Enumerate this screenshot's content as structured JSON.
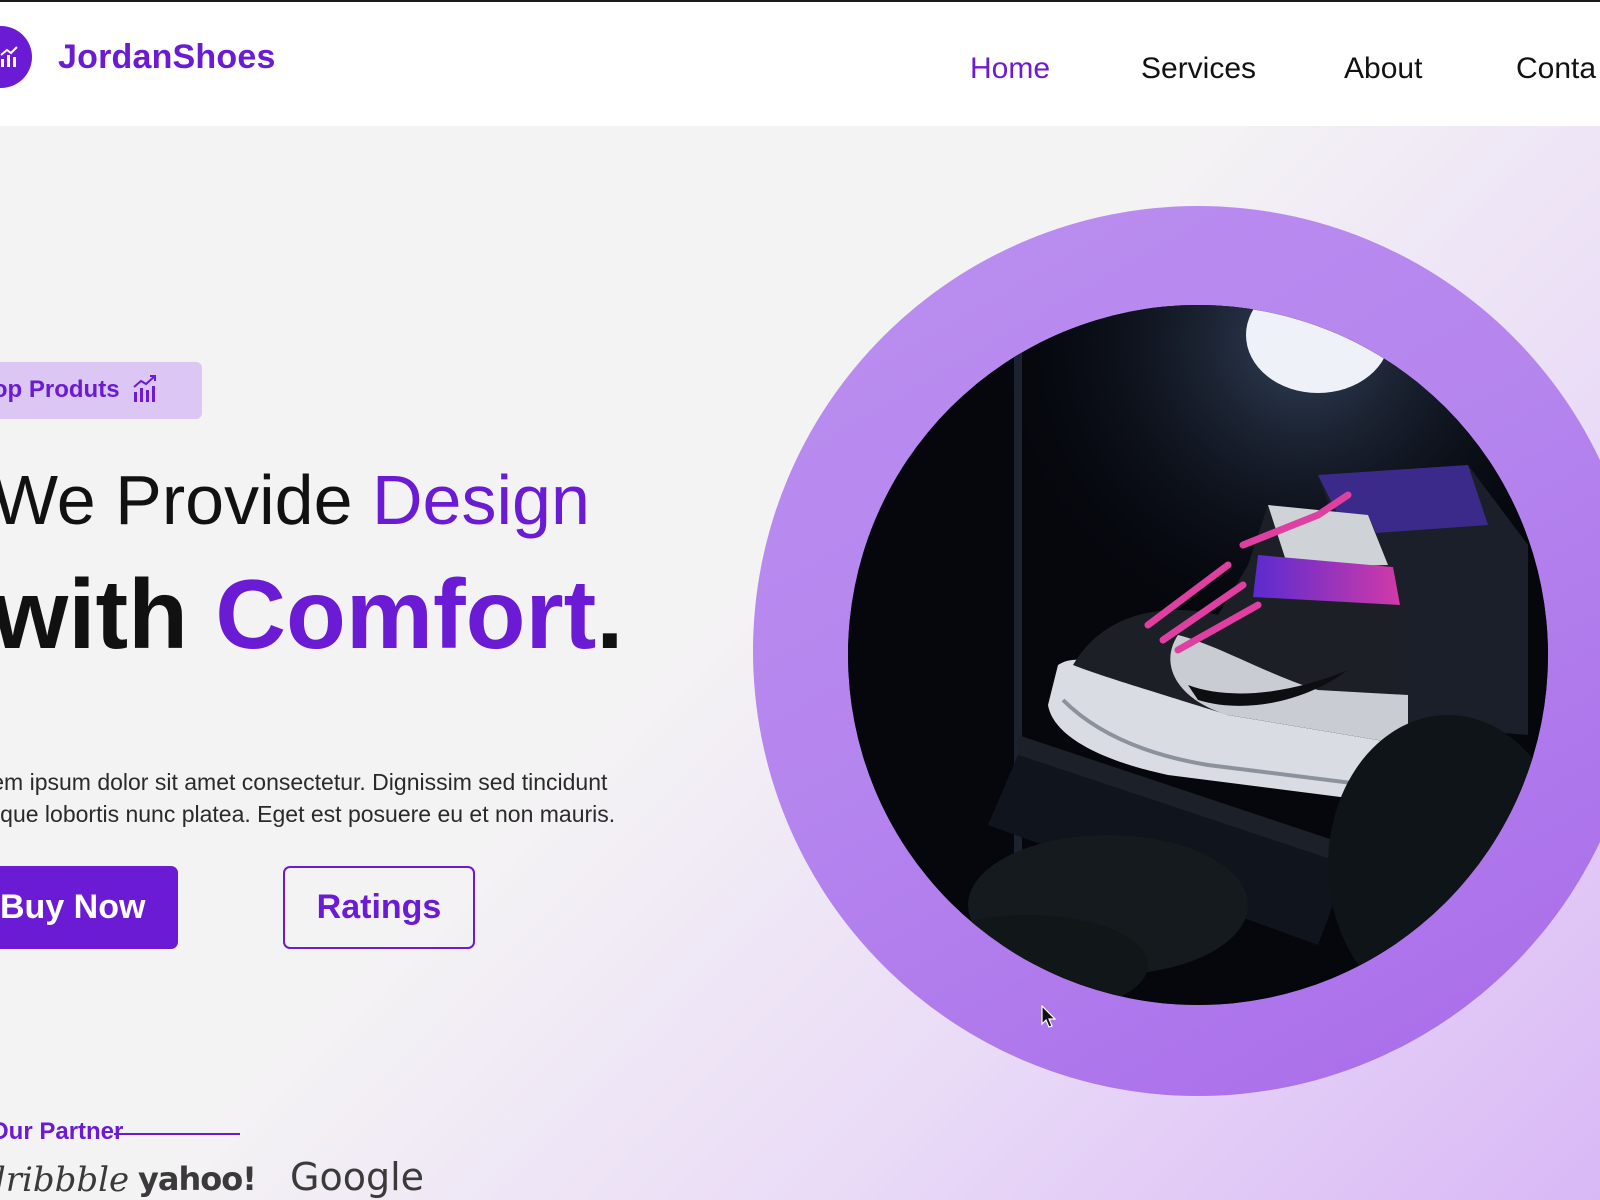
{
  "brand": {
    "name": "JordanShoes",
    "accent_color": "#6a1bd3",
    "logo_icon": "chart-up-icon"
  },
  "nav": {
    "items": [
      {
        "label": "Home",
        "active": true
      },
      {
        "label": "Services",
        "active": false
      },
      {
        "label": "About",
        "active": false
      },
      {
        "label": "Conta",
        "active": false
      }
    ]
  },
  "hero": {
    "badge_label": "Top Produts",
    "badge_icon": "chart-up-icon",
    "headline_line1_plain": "We Provide ",
    "headline_line1_accent": "Design",
    "headline_line2_plain": "with ",
    "headline_line2_accent": "Comfort",
    "headline_line2_end": ".",
    "paragraph_line1": "Lorem ipsum dolor sit amet consectetur. Dignissim sed tincidunt",
    "paragraph_line2": "tristique lobortis nunc platea. Eget est posuere eu et non mauris.",
    "primary_button": "Buy Now",
    "secondary_button": "Ratings",
    "image_subject": "sneaker-photo"
  },
  "partners": {
    "title": "Our Partner",
    "logos": [
      "dribbble",
      "yahoo!",
      "Google"
    ]
  },
  "colors": {
    "ring": "#b585ee",
    "background": "#f3f2f4"
  }
}
